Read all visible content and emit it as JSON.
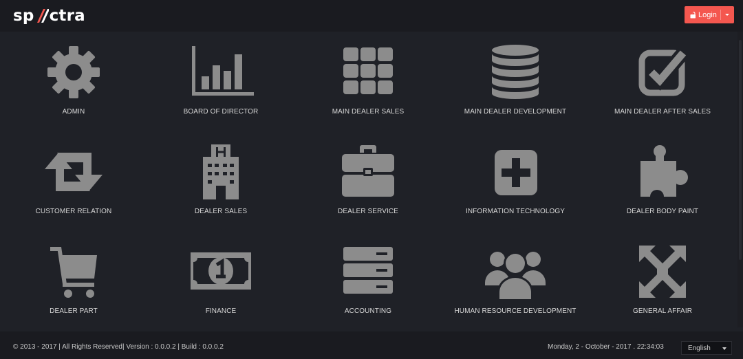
{
  "app": {
    "logo_left": "sp",
    "logo_right": "ctra",
    "logo_icon": "slash-mark-icon",
    "accent_color": "#f4574f",
    "icon_color": "#8c8c8c"
  },
  "header": {
    "login_label": "Login",
    "login_icon": "unlock-icon",
    "login_menu_icon": "caret-down-icon"
  },
  "modules": [
    {
      "label": "ADMIN",
      "icon": "gear-icon"
    },
    {
      "label": "BOARD OF DIRECTOR",
      "icon": "bar-chart-icon"
    },
    {
      "label": "MAIN DEALER SALES",
      "icon": "grid-icon"
    },
    {
      "label": "MAIN DEALER DEVELOPMENT",
      "icon": "database-icon"
    },
    {
      "label": "MAIN DEALER AFTER SALES",
      "icon": "checkbox-icon"
    },
    {
      "label": "CUSTOMER RELATION",
      "icon": "retweet-icon"
    },
    {
      "label": "DEALER SALES",
      "icon": "building-icon"
    },
    {
      "label": "DEALER SERVICE",
      "icon": "briefcase-icon"
    },
    {
      "label": "INFORMATION TECHNOLOGY",
      "icon": "plus-square-icon"
    },
    {
      "label": "DEALER BODY PAINT",
      "icon": "puzzle-icon"
    },
    {
      "label": "DEALER PART",
      "icon": "cart-icon"
    },
    {
      "label": "FINANCE",
      "icon": "money-icon"
    },
    {
      "label": "ACCOUNTING",
      "icon": "server-icon"
    },
    {
      "label": "HUMAN RESOURCE DEVELOPMENT",
      "icon": "users-icon"
    },
    {
      "label": "GENERAL AFFAIR",
      "icon": "expand-arrows-icon"
    }
  ],
  "footer": {
    "copyright": "© 2013 - 2017 | All Rights Reserved| Version : 0.0.0.2 | Build : 0.0.0.2",
    "datetime": "Monday, 2 - October - 2017 . 22:34:03",
    "language": "English"
  }
}
